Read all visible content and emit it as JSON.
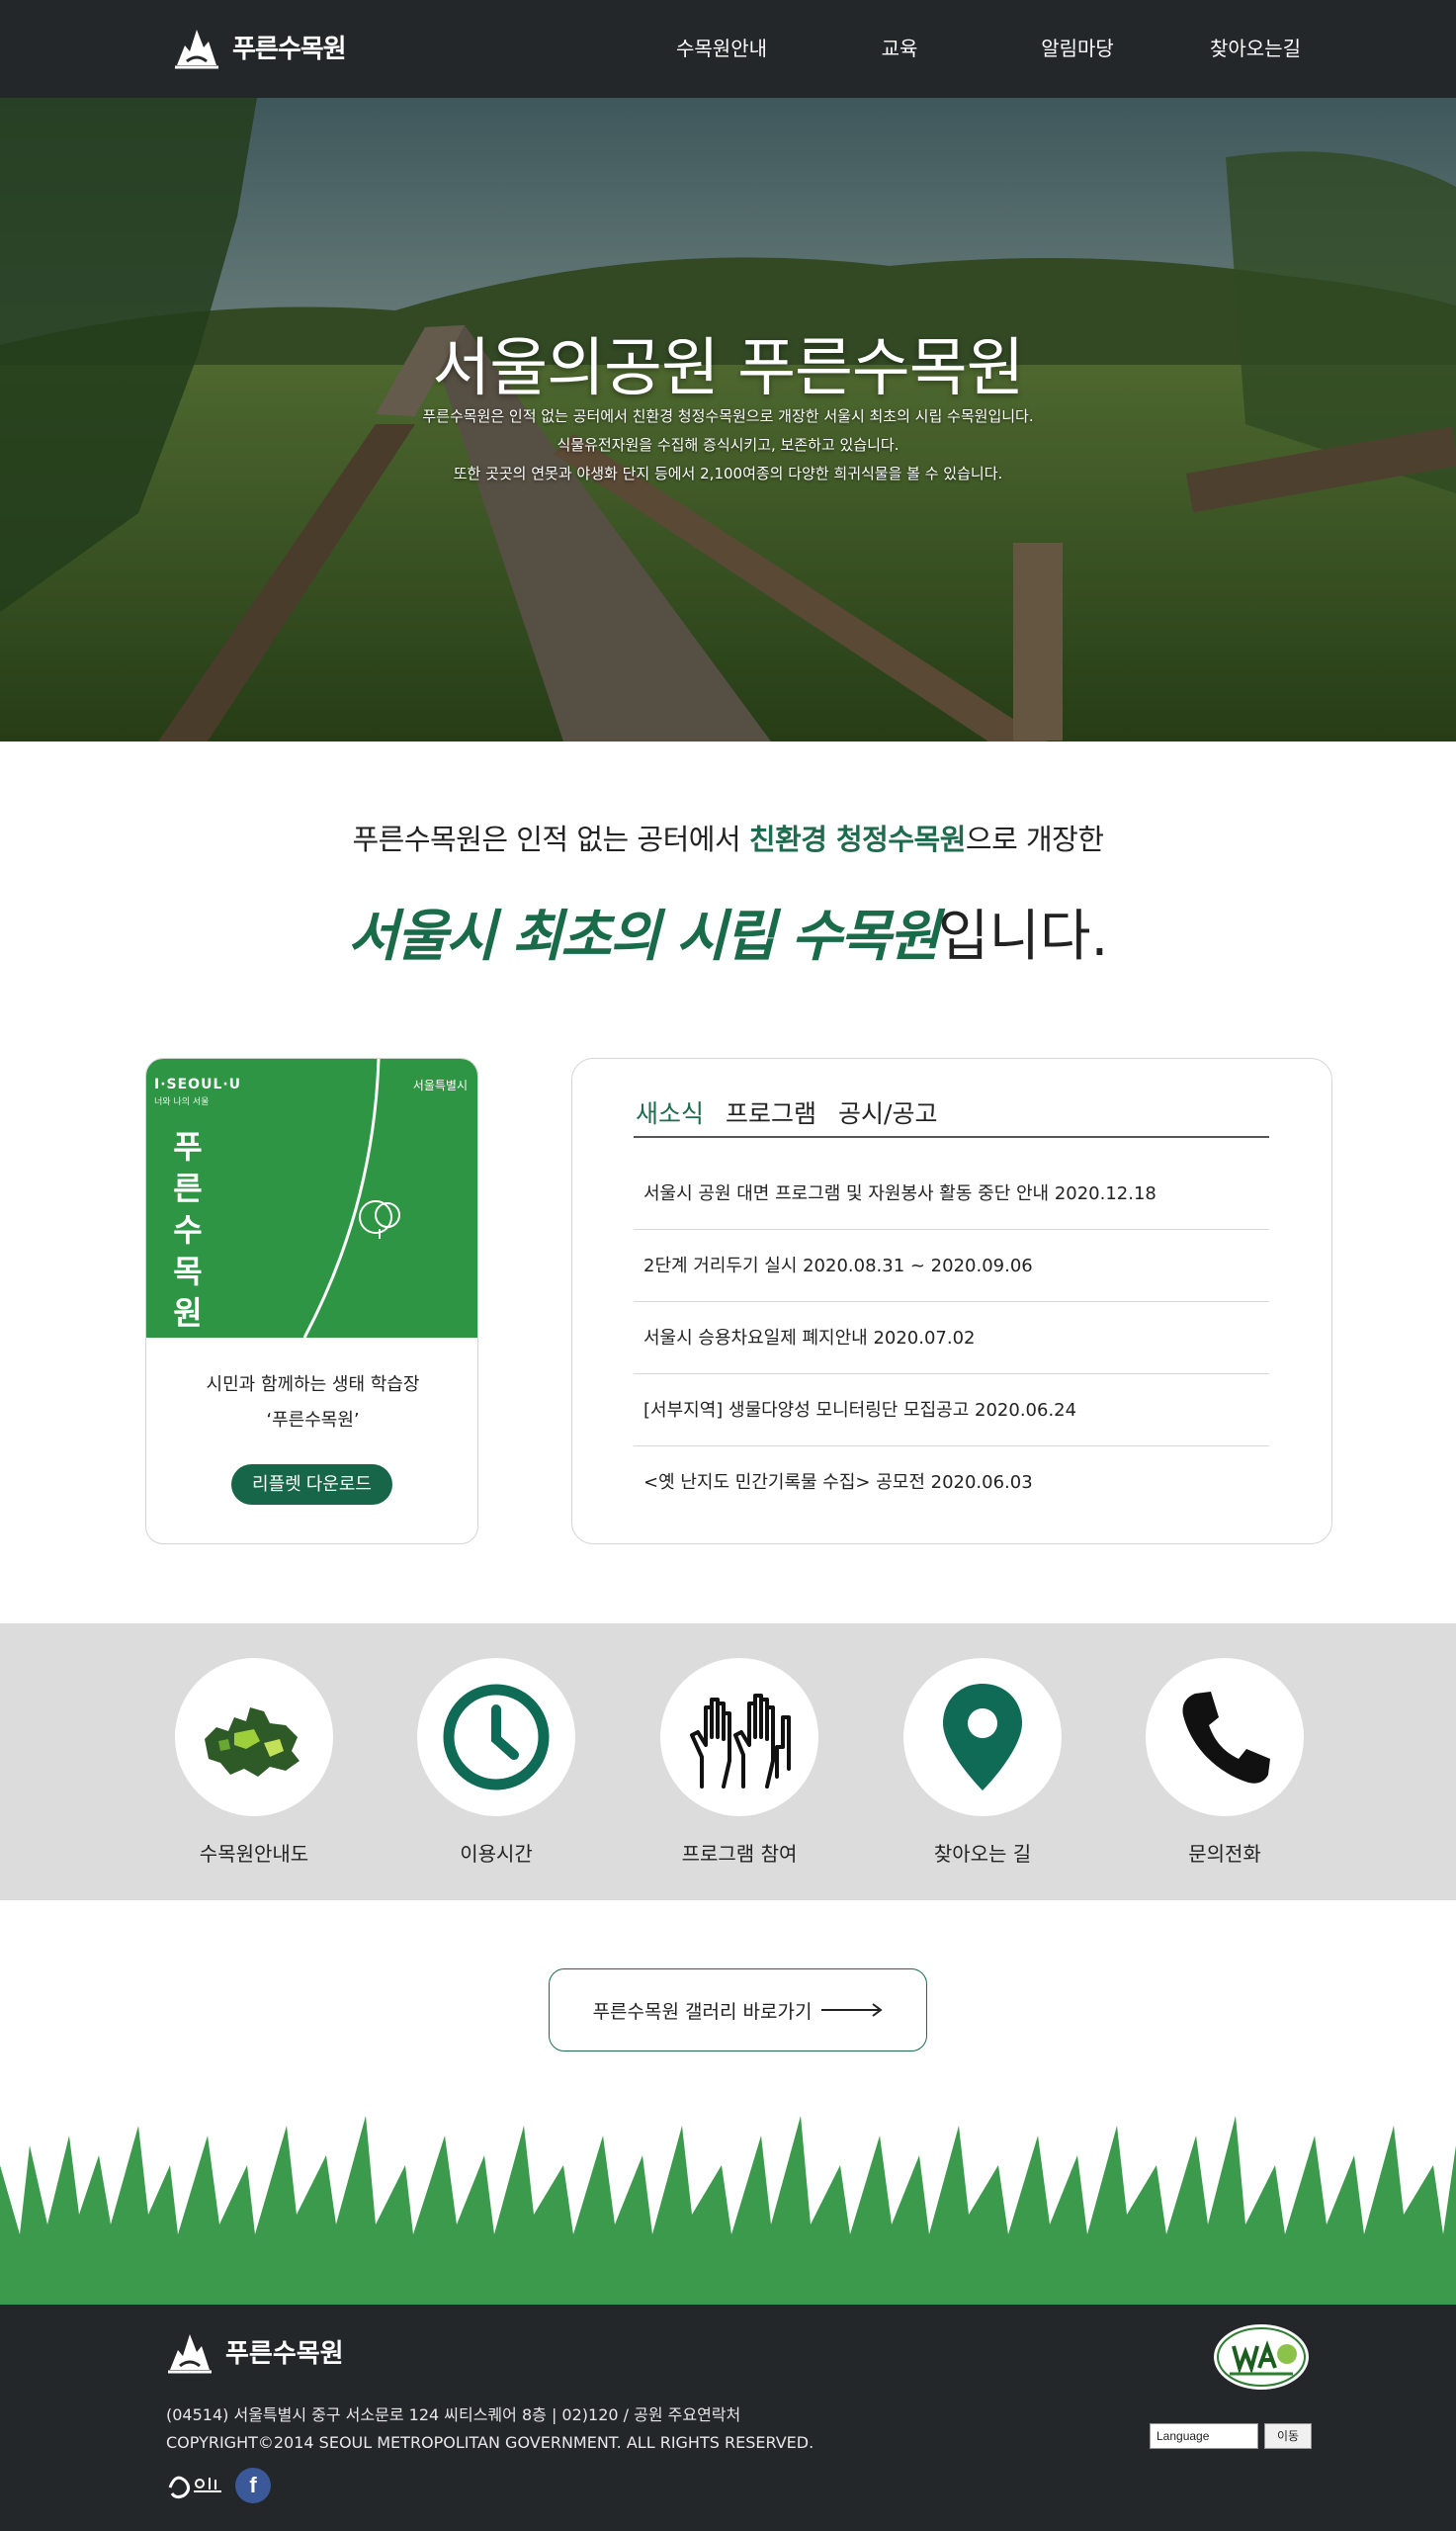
{
  "header": {
    "logo_text": "푸른수목원",
    "nav": [
      "수목원안내",
      "교육",
      "알림마당",
      "찾아오는길"
    ]
  },
  "hero": {
    "title": "서울의공원 푸른수목원",
    "desc": [
      "푸른수목원은 인적 없는 공터에서 친환경 청정수목원으로 개장한 서울시 최초의 시립 수목원입니다.",
      "식물유전자원을 수집해 증식시키고, 보존하고 있습니다.",
      "또한 곳곳의 연못과 야생화 단지 등에서 2,100여종의 다양한 희귀식물을 볼 수 있습니다."
    ]
  },
  "intro": {
    "line1_a": "푸른수목원은 인적 없는 공터에서 ",
    "line1_hl": "친환경 청정수목원",
    "line1_b": "으로 개장한",
    "line2_brush": "서울시 최초의 시립 수목원",
    "line2_b": "입니다."
  },
  "leaflet": {
    "brand": "I·SEOUL·U",
    "brand_sub": "너와 나의 서울",
    "city": "서울특별시",
    "vertical_title": "푸른수목원",
    "text1": "시민과 함께하는 생태 학습장",
    "text2": "‘푸른수목원’",
    "button": "리플렛 다운로드"
  },
  "board": {
    "tabs": [
      "새소식",
      "프로그램",
      "공시/공고"
    ],
    "items": [
      "서울시 공원 대면 프로그램 및 자원봉사 활동 중단 안내 2020.12.18",
      "2단계 거리두기 실시 2020.08.31 ~ 2020.09.06",
      "서울시 승용차요일제 폐지안내 2020.07.02",
      "[서부지역] 생물다양성 모니터링단 모집공고 2020.06.24",
      "<옛 난지도 민간기록물 수집> 공모전 2020.06.03"
    ]
  },
  "quick": [
    {
      "label": "수목원안내도",
      "icon": "map-icon"
    },
    {
      "label": "이용시간",
      "icon": "clock-icon"
    },
    {
      "label": "프로그램 참여",
      "icon": "raised-hands-icon"
    },
    {
      "label": "찾아오는 길",
      "icon": "location-pin-icon"
    },
    {
      "label": "문의전화",
      "icon": "phone-icon"
    }
  ],
  "gallery": {
    "label": "푸른수목원 갤러리 바로가기"
  },
  "footer": {
    "logo_text": "푸른수목원",
    "address": "(04514) 서울특별시 중구 서소문로 124 씨티스퀘어 8층  |  02)120 / 공원 주요연락처",
    "copyright": "COPYRIGHT©2014 SEOUL METROPOLITAN GOVERNMENT. ALL RIGHTS RESERVED.",
    "lang_select": "Language",
    "lang_go": "이동",
    "social": "f"
  },
  "colors": {
    "brand_green": "#1e6b4e",
    "leaf_green": "#2e9544",
    "dark": "#23272a"
  }
}
